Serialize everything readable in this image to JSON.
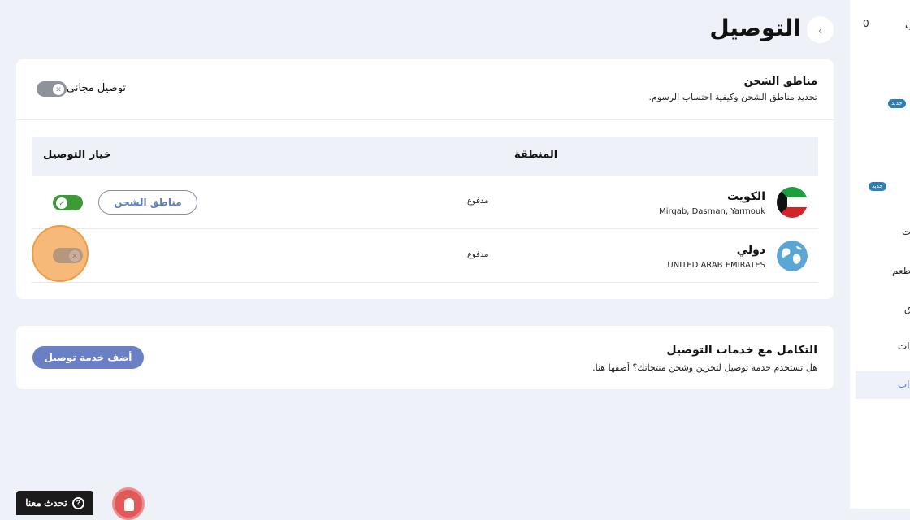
{
  "page": {
    "title": "التوصيل"
  },
  "shipping_zones": {
    "title": "مناطق الشحن",
    "description": "تحديد مناطق الشحن وكيفية احتساب الرسوم.",
    "free_delivery_label": "توصيل مجاني",
    "free_delivery_enabled": false,
    "columns": {
      "region": "المنطقة",
      "delivery_option": "خيار التوصيل"
    },
    "rows": [
      {
        "name": "الكويت",
        "subtitle": "Mirqab, Dasman, Yarmouk",
        "status": "مدفوع",
        "button": "مناطق الشحن",
        "enabled": true,
        "icon": "kuwait-flag-icon"
      },
      {
        "name": "دولي",
        "subtitle": "UNITED ARAB EMIRATES",
        "status": "مدفوع",
        "enabled": false,
        "icon": "globe-icon"
      }
    ]
  },
  "integrations": {
    "title": "التكامل مع خدمات التوصيل",
    "description": "هل تستخدم خدمة توصيل لتخزين وشحن منتجاتك؟ أضفها هنا.",
    "add_button": "أضف خدمة توصيل"
  },
  "sidebar": {
    "count": "0",
    "badge_new": "جديد",
    "fragments": [
      "ب",
      "ت",
      "طعم",
      "ق",
      "ات",
      "ات"
    ]
  },
  "widgets": {
    "chat_label": "تحدث معنا"
  },
  "colors": {
    "accent": "#6b7fc4",
    "toggle_on": "#3c9a37",
    "toggle_off": "#8e929b",
    "highlight": "#f6b97a"
  }
}
